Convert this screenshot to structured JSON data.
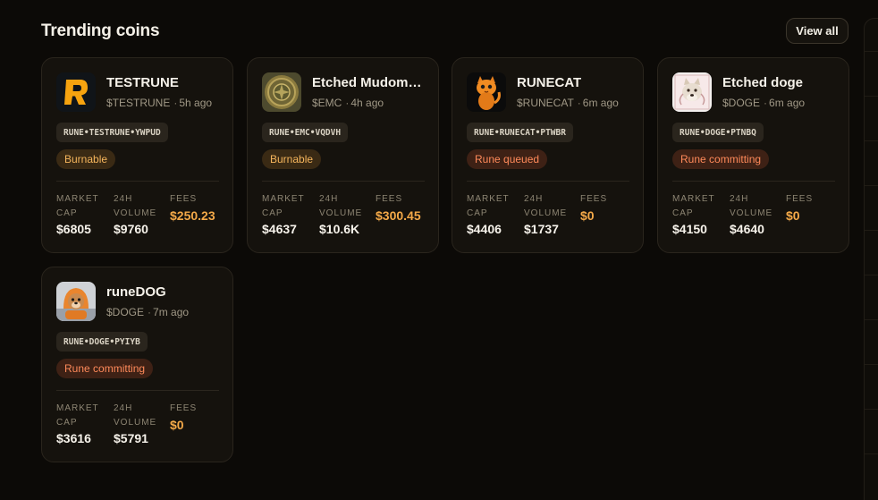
{
  "header": {
    "title": "Trending coins",
    "view_all_label": "View all"
  },
  "labels": {
    "market_cap": "MARKET CAP",
    "volume_24h": "24H VOLUME",
    "fees": "FEES"
  },
  "coins": [
    {
      "name": "TESTRUNE",
      "ticker": "$TESTRUNE",
      "age": "5h ago",
      "rune_id": "RUNE•TESTRUNE•YWPUD",
      "status": "Burnable",
      "status_color": "#f5b55c",
      "market_cap": "$6805",
      "volume": "$9760",
      "fees": "$250.23",
      "icon": "r-logo-icon"
    },
    {
      "name": "Etched Mudomaru",
      "ticker": "$EMC",
      "age": "4h ago",
      "rune_id": "RUNE•EMC•VQDVH",
      "status": "Burnable",
      "status_color": "#f5b55c",
      "market_cap": "$4637",
      "volume": "$10.6K",
      "fees": "$300.45",
      "icon": "gold-coin-icon"
    },
    {
      "name": "RUNECAT",
      "ticker": "$RUNECAT",
      "age": "6m ago",
      "rune_id": "RUNE•RUNECAT•PTWBR",
      "status": "Rune queued",
      "status_color": "#ff8a5a",
      "market_cap": "$4406",
      "volume": "$1737",
      "fees": "$0",
      "icon": "cat-icon"
    },
    {
      "name": "Etched doge",
      "ticker": "$DOGE",
      "age": "6m ago",
      "rune_id": "RUNE•DOGE•PTNBQ",
      "status": "Rune committing",
      "status_color": "#ff8a5a",
      "market_cap": "$4150",
      "volume": "$4640",
      "fees": "$0",
      "icon": "doge-icon"
    },
    {
      "name": "runeDOG",
      "ticker": "$DOGE",
      "age": "7m ago",
      "rune_id": "RUNE•DOGE•PYIYB",
      "status": "Rune committing",
      "status_color": "#ff8a5a",
      "market_cap": "$3616",
      "volume": "$5791",
      "fees": "$0",
      "icon": "hooded-dog-icon"
    }
  ]
}
